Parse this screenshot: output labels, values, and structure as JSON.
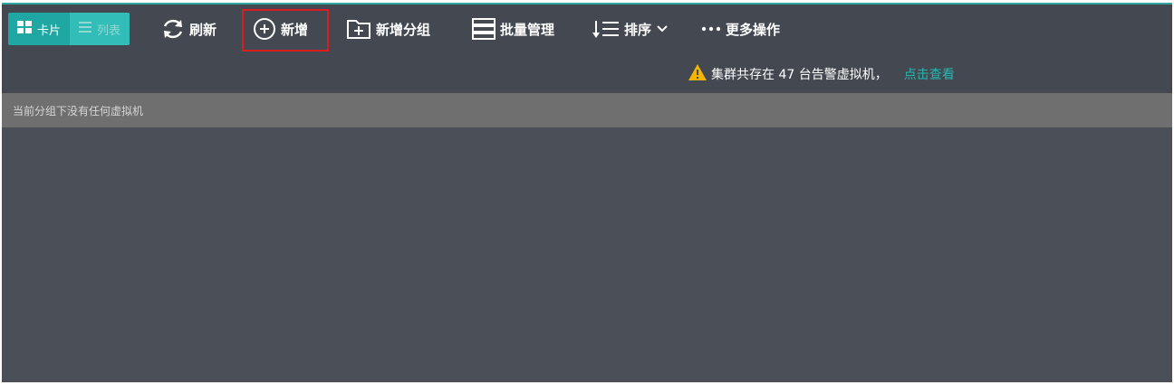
{
  "toolbar": {
    "view_toggle": {
      "card_label": "卡片",
      "list_label": "列表"
    },
    "refresh_label": "刷新",
    "add_label": "新增",
    "add_group_label": "新增分组",
    "batch_label": "批量管理",
    "sort_label": "排序",
    "more_label": "更多操作"
  },
  "alert": {
    "text": "集群共存在 47 台告警虚拟机，",
    "link": "点击查看"
  },
  "empty_message": "当前分组下没有任何虚拟机",
  "colors": {
    "accent": "#1fa7a3",
    "link": "#27b7b1",
    "warning": "#f5b400",
    "highlight_border": "#d81e1e",
    "toolbar_bg": "#434851",
    "content_bg": "#4b5058",
    "empty_bar_bg": "#6f6f70"
  }
}
